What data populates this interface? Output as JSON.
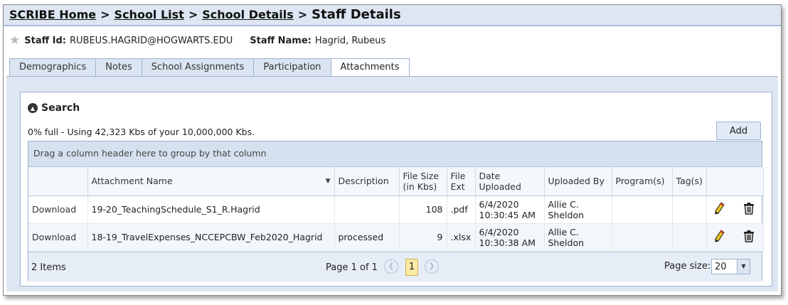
{
  "breadcrumb": {
    "home": "SCRIBE Home",
    "school_list": "School List",
    "school_details": "School Details",
    "current": "Staff Details",
    "separator": ">"
  },
  "staff": {
    "id_label": "Staff Id:",
    "id_value": "RUBEUS.HAGRID@HOGWARTS.EDU",
    "name_label": "Staff Name:",
    "name_value": "Hagrid, Rubeus"
  },
  "tabs": [
    {
      "label": "Demographics"
    },
    {
      "label": "Notes"
    },
    {
      "label": "School Assignments"
    },
    {
      "label": "Participation"
    },
    {
      "label": "Attachments",
      "active": true
    }
  ],
  "search": {
    "label": "Search",
    "usage": "0% full - Using 42,323 Kbs of your 10,000,000 Kbs.",
    "add_label": "Add"
  },
  "grid": {
    "group_hint": "Drag a column header here to group by that column",
    "columns": {
      "attachment_name": "Attachment Name",
      "description": "Description",
      "file_size": "File Size (in Kbs)",
      "file_ext": "File Ext",
      "date_uploaded": "Date Uploaded",
      "uploaded_by": "Uploaded By",
      "programs": "Program(s)",
      "tags": "Tag(s)"
    },
    "rows": [
      {
        "action": "Download",
        "name": "19-20_TeachingSchedule_S1_R.Hagrid",
        "description": "",
        "size": "108",
        "ext": ".pdf",
        "date": "6/4/2020",
        "time": "10:30:45 AM",
        "by_first": "Allie C.",
        "by_last": "Sheldon",
        "programs": "",
        "tags": ""
      },
      {
        "action": "Download",
        "name": "18-19_TravelExpenses_NCCEPCBW_Feb2020_Hagrid",
        "description": "processed",
        "size": "9",
        "ext": ".xlsx",
        "date": "6/4/2020",
        "time": "10:30:38 AM",
        "by_first": "Allie C.",
        "by_last": "Sheldon",
        "programs": "",
        "tags": ""
      }
    ]
  },
  "pager": {
    "items": "2 Items",
    "page_info": "Page 1 of 1",
    "current_page": "1",
    "page_size_label": "Page size:",
    "page_size": "20"
  },
  "icons": {
    "star": "star-icon",
    "search_toggle": "collapse-circle-icon",
    "sort": "sort-down-icon",
    "edit": "pencil-icon",
    "delete": "trash-icon",
    "prev": "chevron-left-icon",
    "next": "chevron-right-icon",
    "dropdown": "chevron-down-icon"
  },
  "colors": {
    "header_bg": "#dde6f2",
    "active_page": "#fbe9a4",
    "border": "#9db2cf"
  }
}
